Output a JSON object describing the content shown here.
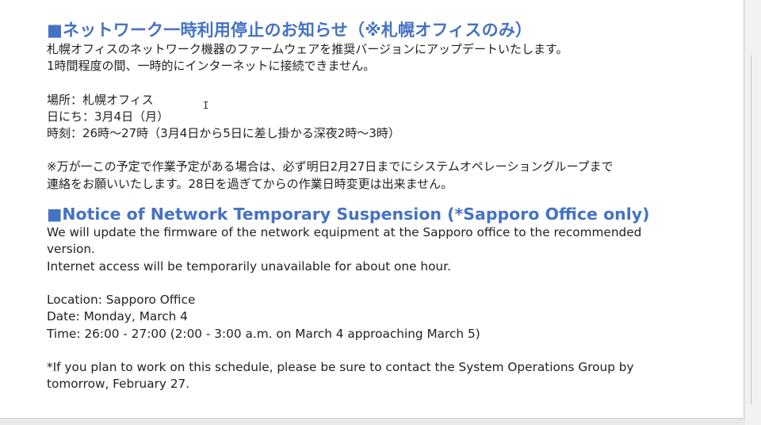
{
  "notice_jp": {
    "title": "■ネットワーク一時利用停止のお知らせ（※札幌オフィスのみ）",
    "lines": [
      "札幌オフィスのネットワーク機器のファームウェアを推奨バージョンにアップデートいたします。",
      "1時間程度の間、一時的にインターネットに接続できません。"
    ],
    "details": [
      "場所：札幌オフィス",
      "日にち：3月4日（月）",
      "時刻：26時～27時（3月4日から5日に差し掛かる深夜2時～3時）"
    ],
    "note": [
      "※万が一この予定で作業予定がある場合は、必ず明日2月27日までにシステムオペレーショングループまで",
      "連絡をお願いいたします。28日を過ぎてからの作業日時変更は出来ません。"
    ]
  },
  "notice_en": {
    "title": "■Notice of Network Temporary Suspension (*Sapporo Office only)",
    "lines": [
      "We will update the firmware of the network equipment at the Sapporo office to the recommended",
      "version.",
      "Internet access will be temporarily unavailable for about one hour."
    ],
    "details": [
      "Location: Sapporo Office",
      "Date: Monday, March 4",
      "Time: 26:00 - 27:00 (2:00 - 3:00 a.m. on March 4 approaching March 5)"
    ],
    "note": [
      "*If you plan to work on this schedule, please be sure to contact the System Operations Group by",
      "tomorrow, February 27."
    ]
  },
  "cursor_glyph": "I",
  "colors": {
    "heading": "#4472c4",
    "text": "#222222",
    "page_background": "#ffffff"
  }
}
